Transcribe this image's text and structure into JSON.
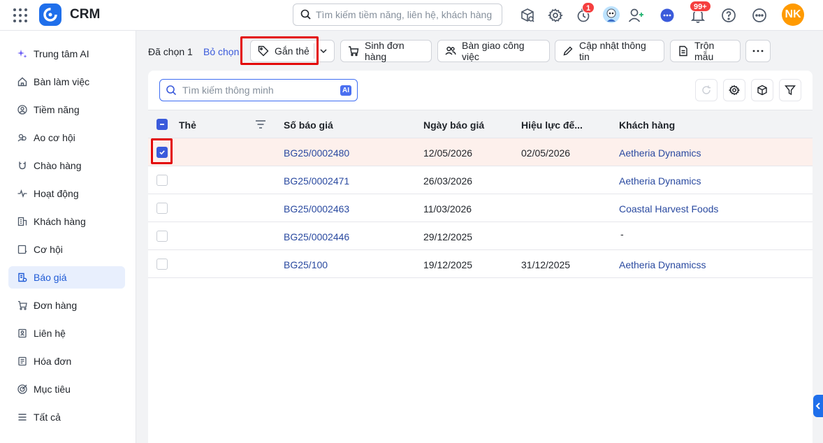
{
  "app": {
    "title": "CRM",
    "search_placeholder": "Tìm kiếm tiềm năng, liên hệ, khách hàng",
    "timer_badge": "1",
    "notification_badge": "99+",
    "user_initials": "NK"
  },
  "sidebar": {
    "items": [
      {
        "label": "Trung tâm AI",
        "icon": "sparkle-icon"
      },
      {
        "label": "Bàn làm việc",
        "icon": "home-icon"
      },
      {
        "label": "Tiềm năng",
        "icon": "person-circle-icon"
      },
      {
        "label": "Ao cơ hội",
        "icon": "people-icon"
      },
      {
        "label": "Chào hàng",
        "icon": "magnet-icon"
      },
      {
        "label": "Hoạt động",
        "icon": "activity-icon"
      },
      {
        "label": "Khách hàng",
        "icon": "building-icon"
      },
      {
        "label": "Cơ hội",
        "icon": "opportunity-icon"
      },
      {
        "label": "Báo giá",
        "icon": "quote-icon",
        "active": true
      },
      {
        "label": "Đơn hàng",
        "icon": "cart-icon"
      },
      {
        "label": "Liên hệ",
        "icon": "contact-icon"
      },
      {
        "label": "Hóa đơn",
        "icon": "invoice-icon"
      },
      {
        "label": "Mục tiêu",
        "icon": "target-icon"
      },
      {
        "label": "Tất cả",
        "icon": "menu-icon"
      }
    ]
  },
  "toolbar": {
    "selected_count": "Đã chọn 1",
    "deselect": "Bỏ chọn",
    "tag": "Gắn thẻ",
    "create_order": "Sinh đơn hàng",
    "handover": "Bàn giao công việc",
    "update_info": "Cập nhật thông tin",
    "mail_merge": "Trộn mẫu"
  },
  "table": {
    "search_placeholder": "Tìm kiếm thông minh",
    "ai_label": "AI",
    "headers": {
      "tag": "Thẻ",
      "number": "Số báo giá",
      "date": "Ngày báo giá",
      "valid": "Hiệu lực đế...",
      "customer": "Khách hàng"
    },
    "rows": [
      {
        "number": "BG25/0002480",
        "date": "12/05/2026",
        "valid": "02/05/2026",
        "customer": "Aetheria Dynamics",
        "checked": true
      },
      {
        "number": "BG25/0002471",
        "date": "26/03/2026",
        "valid": "",
        "customer": "Aetheria Dynamics",
        "checked": false
      },
      {
        "number": "BG25/0002463",
        "date": "11/03/2026",
        "valid": "",
        "customer": "Coastal Harvest Foods",
        "checked": false
      },
      {
        "number": "BG25/0002446",
        "date": "29/12/2025",
        "valid": "",
        "customer": "-",
        "checked": false
      },
      {
        "number": "BG25/100",
        "date": "19/12/2025",
        "valid": "31/12/2025",
        "customer": "Aetheria Dynamicss",
        "checked": false
      }
    ]
  },
  "colors": {
    "accent": "#1f6feb",
    "highlight": "#e3090a",
    "selected_row": "#fdf0ec"
  }
}
